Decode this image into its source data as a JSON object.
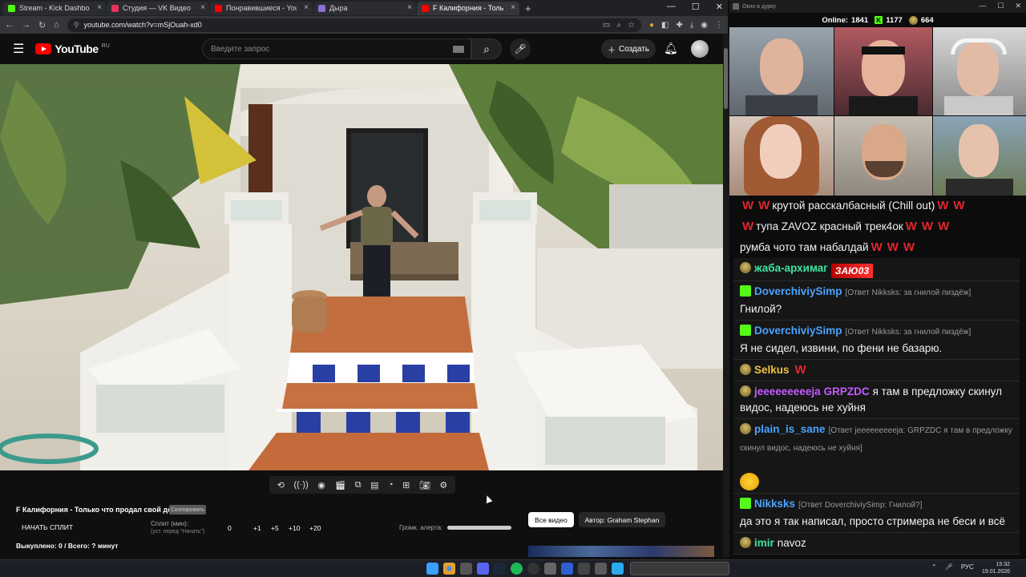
{
  "browser": {
    "tabs": [
      {
        "title": "Stream - Kick Dashboard",
        "color": "#53fc18"
      },
      {
        "title": "Студия — VK Видео Live",
        "color": "#e4335a"
      },
      {
        "title": "Понравившиеся - YouTube",
        "color": "#ff0000"
      },
      {
        "title": "Дыра",
        "color": "#8b6fd6"
      },
      {
        "title": "F Калифорния - Только что",
        "color": "#ff0000"
      }
    ],
    "url": "youtube.com/watch?v=mSjOuah-xd0"
  },
  "youtube": {
    "logo_text": "YouTube",
    "region": "RU",
    "search_placeholder": "Введите запрос",
    "create_label": "Создать",
    "video_title": "F Калифорния - Только что продал свой дом.",
    "copy_label": "Скопировать",
    "start_split": "НАЧАТЬ СПЛИТ",
    "split_label": "Сплит (мин):",
    "split_sub": "(уст. перед \"Начать\")",
    "split_values": [
      "0",
      "+1",
      "+5",
      "+10",
      "+20"
    ],
    "alert_label": "Громк. алерта:",
    "alert_volume": 1.0,
    "all_videos": "Все видео",
    "author": "Автор: Graham Stephan",
    "bought": "Выкуплено: 0 / Всего: ? минут"
  },
  "stream_panel": {
    "window_title": "Окно в дурку",
    "online_label": "Online:",
    "online_count": "1841",
    "kick_count": "1177",
    "frog_count": "664"
  },
  "chat": [
    {
      "type": "plain",
      "text": "крутой расскалбасный (Chill out)",
      "pre_w": 2,
      "post_w": 2
    },
    {
      "type": "plain",
      "text": "тупа ZAVOZ красный трек4ок",
      "pre_w": 1,
      "post_w": 3
    },
    {
      "type": "plain",
      "text": "румба чото там набалдай",
      "pre_w": 0,
      "post_w": 3
    },
    {
      "badge": "frog",
      "nick": "жаба-архимаг",
      "color": "#3ee6a0",
      "emote": "ЗАЮ03"
    },
    {
      "badge": "kick",
      "nick": "DoverchiviySimp",
      "color": "#4aa3ff",
      "reply": "[Ответ Nikksks: за гнилой пиздёж]",
      "text": "Гнилой?"
    },
    {
      "badge": "kick",
      "nick": "DoverchiviySimp",
      "color": "#4aa3ff",
      "reply": "[Ответ Nikksks: за гнилой пиздёж]",
      "text": "Я не сидел, извини, по фени не базарю."
    },
    {
      "badge": "frog",
      "nick": "Selkus",
      "color": "#f0c040",
      "w": 1
    },
    {
      "badge": "frog",
      "nick": "jeeeeeeeeeja",
      "color": "#c45cff",
      "nick2": "GRPZDC",
      "color2": "#c45cff",
      "text": "я там в предложку скинул видос, надеюсь не хуйня"
    },
    {
      "badge": "frog",
      "nick": "plain_is_sane",
      "color": "#4aa3ff",
      "reply": "[Ответ jeeeeeeeeeja: GRPZDC я там в предложку скинул видос, надеюсь не хуйня]",
      "laugh": true
    },
    {
      "badge": "kick",
      "nick": "Nikksks",
      "color": "#4aa3ff",
      "reply": "[Ответ DoverchiviySimp: Гнилой?]",
      "text": "да это я так написал, просто стримера не беси и всё"
    },
    {
      "badge": "frog",
      "nick": "imir",
      "color": "#3ee6a0",
      "text": "navoz"
    }
  ],
  "taskbar": {
    "lang": "РУС",
    "time": "15:32",
    "date": "19.01.2026"
  }
}
